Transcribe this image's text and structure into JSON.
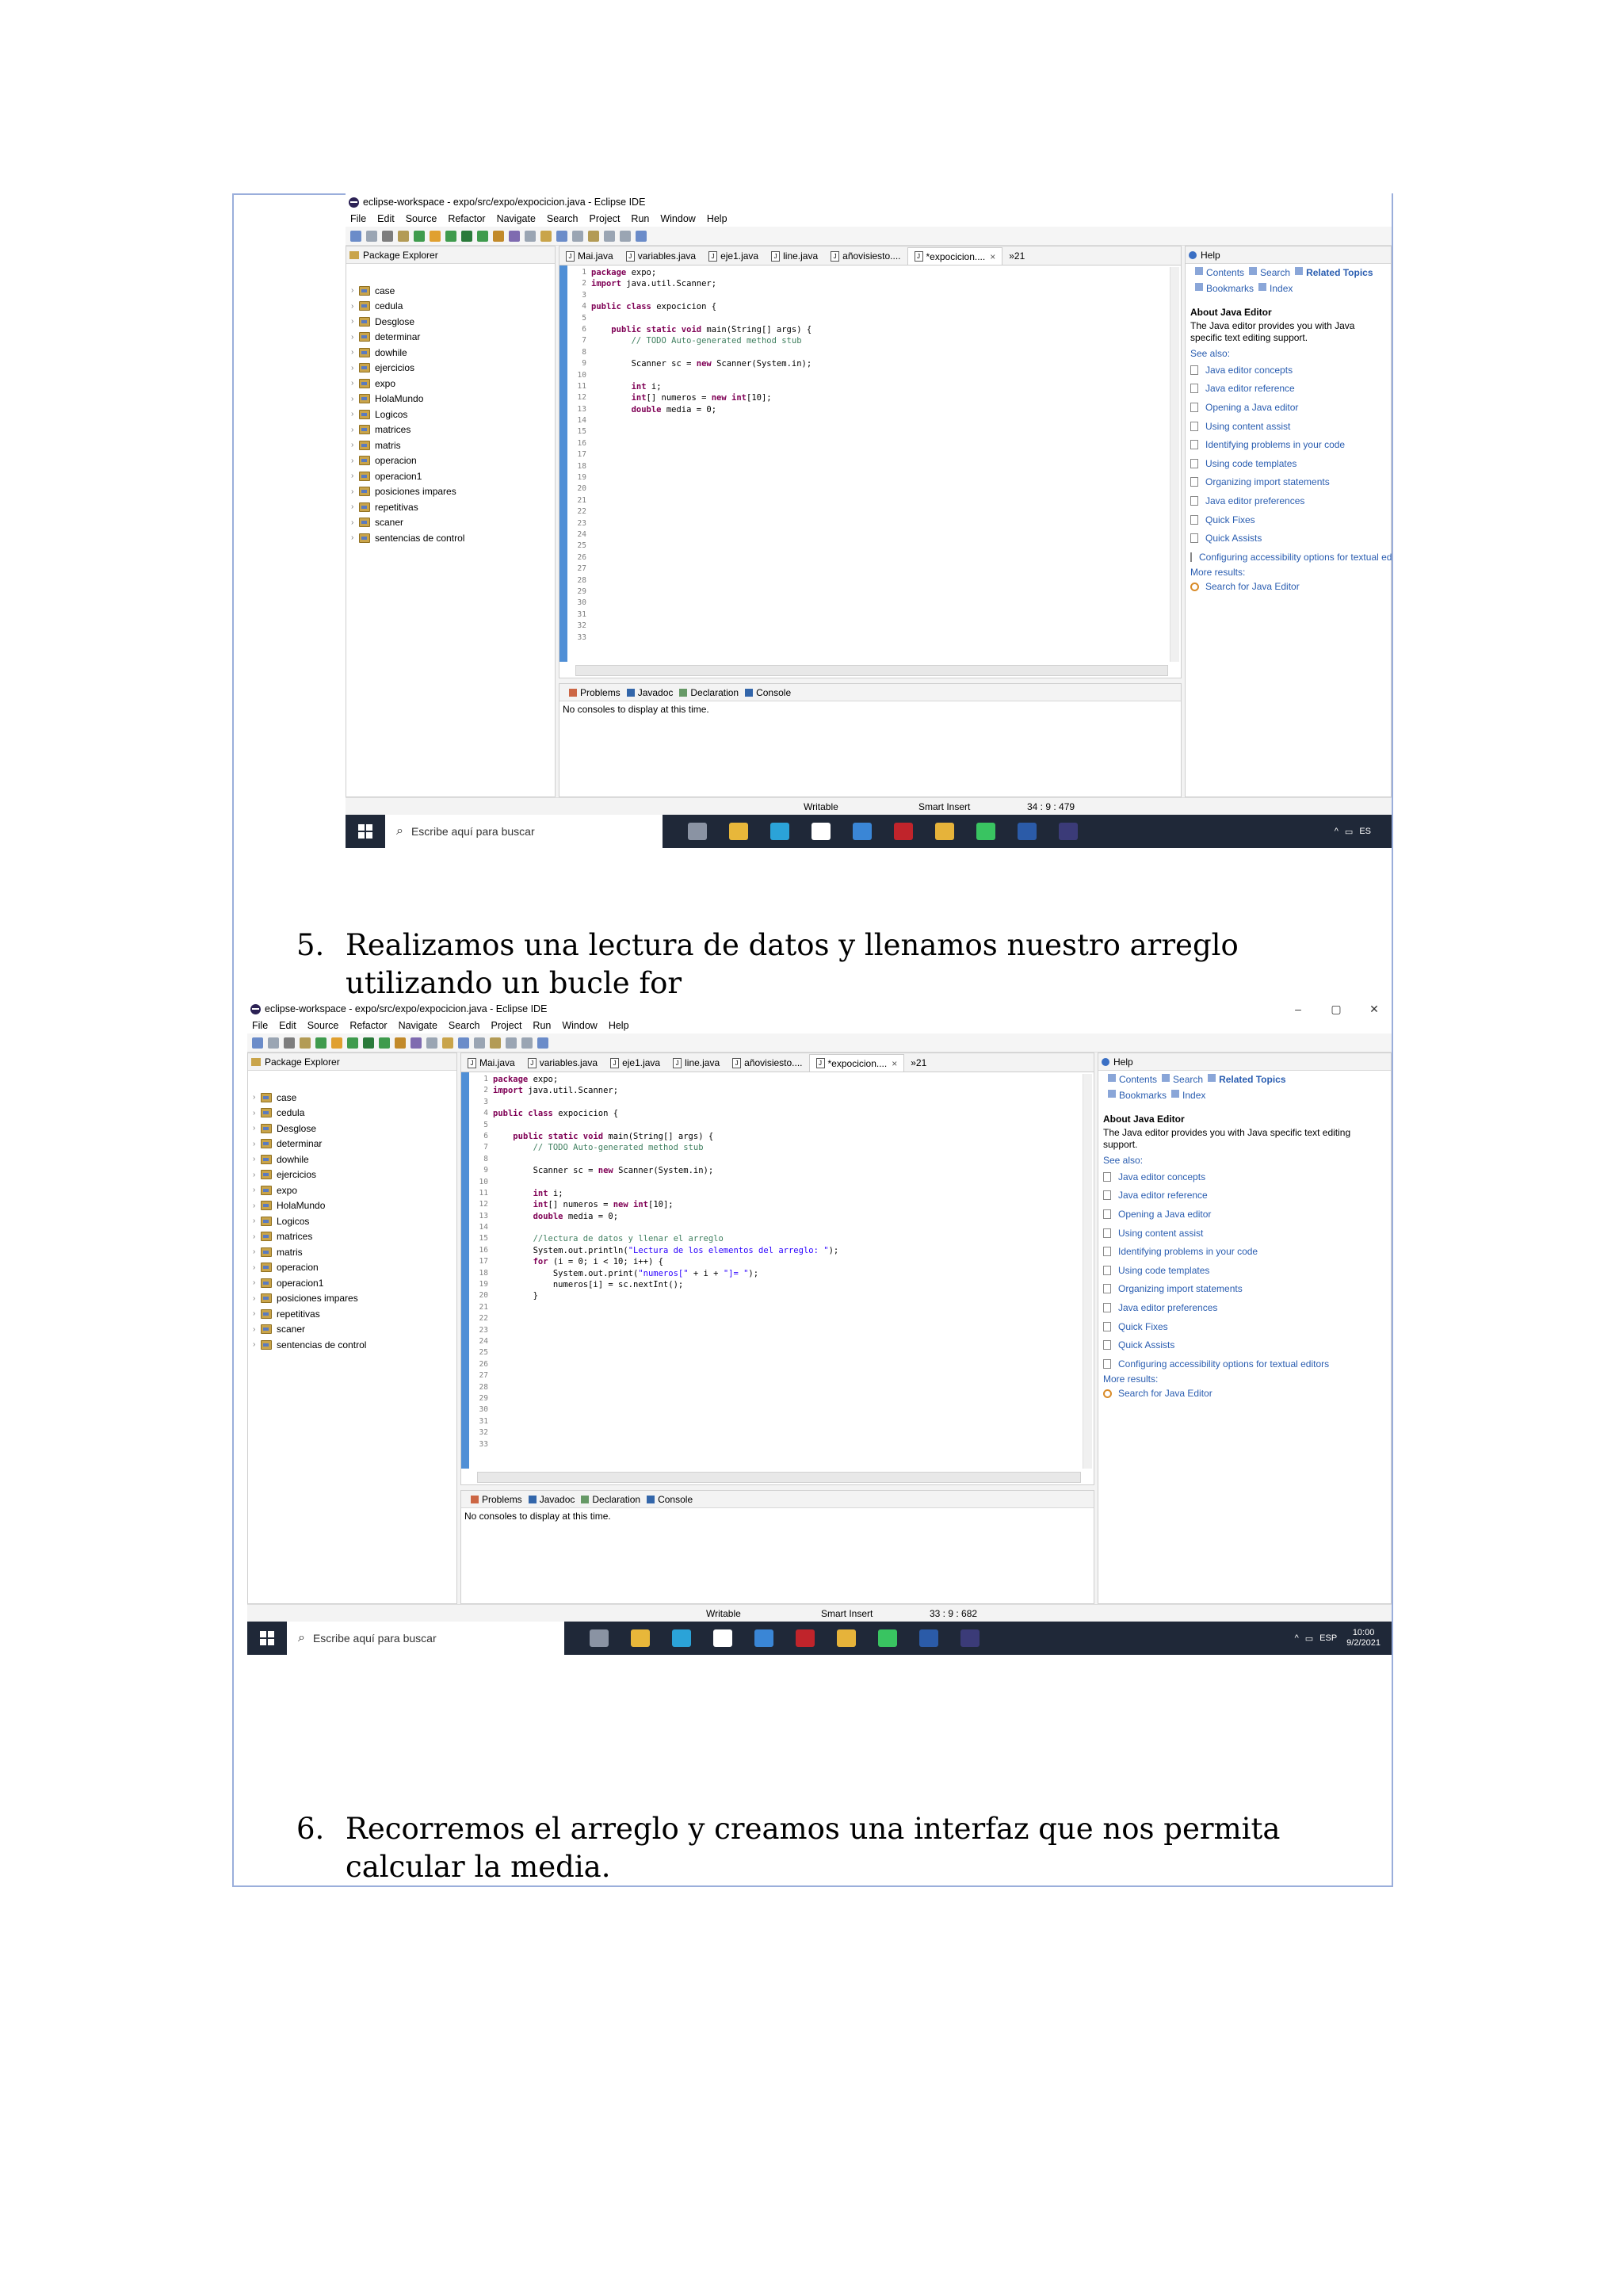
{
  "steps": [
    {
      "number": "5.",
      "text": "Realizamos una lectura de datos y llenamos nuestro arreglo utilizando un bucle for"
    },
    {
      "number": "6.",
      "text": "Recorremos el arreglo y creamos una interfaz que nos permita calcular la media."
    }
  ],
  "shots": [
    {
      "window_title": "eclipse-workspace - expo/src/expo/expocicion.java - Eclipse IDE",
      "menu": [
        "File",
        "Edit",
        "Source",
        "Refactor",
        "Navigate",
        "Search",
        "Project",
        "Run",
        "Window",
        "Help"
      ],
      "explorer_title": "Package Explorer",
      "projects": [
        "case",
        "cedula",
        "Desglose",
        "determinar",
        "dowhile",
        "ejercicios",
        "expo",
        "HolaMundo",
        "Logicos",
        "matrices",
        "matris",
        "operacion",
        "operacion1",
        "posiciones impares",
        "repetitivas",
        "scaner",
        "sentencias de control"
      ],
      "editor_tabs": [
        "Mai.java",
        "variables.java",
        "eje1.java",
        "line.java",
        "añovisiesto....",
        "*expocicion...."
      ],
      "tab_overflow": "»21",
      "code": [
        [
          [
            "kw",
            "package "
          ],
          [
            "",
            "expo;"
          ]
        ],
        [
          [
            "kw",
            "import "
          ],
          [
            "",
            "java.util.Scanner;"
          ]
        ],
        [
          [
            "",
            ""
          ]
        ],
        [
          [
            "kw",
            "public class "
          ],
          [
            "",
            "expocicion {"
          ]
        ],
        [
          [
            "",
            ""
          ]
        ],
        [
          [
            "",
            "    "
          ],
          [
            "kw",
            "public static void "
          ],
          [
            "",
            "main(String[] args) {"
          ]
        ],
        [
          [
            "",
            "        "
          ],
          [
            "cm",
            "// TODO Auto-generated method stub"
          ]
        ],
        [
          [
            "",
            ""
          ]
        ],
        [
          [
            "",
            "        Scanner sc = "
          ],
          [
            "kw",
            "new "
          ],
          [
            "",
            "Scanner(System.in);"
          ]
        ],
        [
          [
            "",
            ""
          ]
        ],
        [
          [
            "",
            "        "
          ],
          [
            "kw",
            "int "
          ],
          [
            "",
            "i;"
          ]
        ],
        [
          [
            "",
            "        "
          ],
          [
            "kw",
            "int"
          ],
          [
            "",
            "[] numeros = "
          ],
          [
            "kw",
            "new int"
          ],
          [
            "",
            "[10];"
          ]
        ],
        [
          [
            "",
            "        "
          ],
          [
            "kw",
            "double "
          ],
          [
            "",
            "media = 0;"
          ]
        ]
      ],
      "line_count": 33,
      "console_tabs": [
        "Problems",
        "Javadoc",
        "Declaration",
        "Console"
      ],
      "console_message": "No consoles to display at this time.",
      "help": {
        "title": "Help",
        "nav": [
          "Contents",
          "Search",
          "Related Topics"
        ],
        "nav2": [
          "Bookmarks",
          "Index"
        ],
        "about_title": "About Java Editor",
        "about_text": "The Java editor provides you with Java specific text editing support.",
        "see_also": "See also:",
        "links": [
          "Java editor concepts",
          "Java editor reference",
          "Opening a Java editor",
          "Using content assist",
          "Identifying problems in your code",
          "Using code templates",
          "Organizing import statements",
          "Java editor preferences",
          "Quick Fixes",
          "Quick Assists",
          "Configuring accessibility options for textual editors"
        ],
        "more_results": "More results:",
        "search_link": "Search for Java Editor"
      },
      "status": {
        "mode": "Writable",
        "insert": "Smart Insert",
        "position": "34 : 9 : 479"
      },
      "taskbar": {
        "search_placeholder": "Escribe aquí para buscar",
        "lang": "ES",
        "time": "",
        "date": ""
      }
    },
    {
      "window_title": "eclipse-workspace - expo/src/expo/expocicion.java - Eclipse IDE",
      "menu": [
        "File",
        "Edit",
        "Source",
        "Refactor",
        "Navigate",
        "Search",
        "Project",
        "Run",
        "Window",
        "Help"
      ],
      "explorer_title": "Package Explorer",
      "projects": [
        "case",
        "cedula",
        "Desglose",
        "determinar",
        "dowhile",
        "ejercicios",
        "expo",
        "HolaMundo",
        "Logicos",
        "matrices",
        "matris",
        "operacion",
        "operacion1",
        "posiciones impares",
        "repetitivas",
        "scaner",
        "sentencias de control"
      ],
      "editor_tabs": [
        "Mai.java",
        "variables.java",
        "eje1.java",
        "line.java",
        "añovisiesto....",
        "*expocicion...."
      ],
      "tab_overflow": "»21",
      "code": [
        [
          [
            "kw",
            "package "
          ],
          [
            "",
            "expo;"
          ]
        ],
        [
          [
            "kw",
            "import "
          ],
          [
            "",
            "java.util.Scanner;"
          ]
        ],
        [
          [
            "",
            ""
          ]
        ],
        [
          [
            "kw",
            "public class "
          ],
          [
            "",
            "expocicion {"
          ]
        ],
        [
          [
            "",
            ""
          ]
        ],
        [
          [
            "",
            "    "
          ],
          [
            "kw",
            "public static void "
          ],
          [
            "",
            "main(String[] args) {"
          ]
        ],
        [
          [
            "",
            "        "
          ],
          [
            "cm",
            "// TODO Auto-generated method stub"
          ]
        ],
        [
          [
            "",
            ""
          ]
        ],
        [
          [
            "",
            "        Scanner sc = "
          ],
          [
            "kw",
            "new "
          ],
          [
            "",
            "Scanner(System.in);"
          ]
        ],
        [
          [
            "",
            ""
          ]
        ],
        [
          [
            "",
            "        "
          ],
          [
            "kw",
            "int "
          ],
          [
            "",
            "i;"
          ]
        ],
        [
          [
            "",
            "        "
          ],
          [
            "kw",
            "int"
          ],
          [
            "",
            "[] numeros = "
          ],
          [
            "kw",
            "new int"
          ],
          [
            "",
            "[10];"
          ]
        ],
        [
          [
            "",
            "        "
          ],
          [
            "kw",
            "double "
          ],
          [
            "",
            "media = 0;"
          ]
        ],
        [
          [
            "",
            ""
          ]
        ],
        [
          [
            "",
            "        "
          ],
          [
            "cm",
            "//lectura de datos y llenar el arreglo"
          ]
        ],
        [
          [
            "",
            "        System.out.println("
          ],
          [
            "st",
            "\"Lectura de los elementos del arreglo: \""
          ],
          [
            "",
            ");"
          ]
        ],
        [
          [
            "",
            "        "
          ],
          [
            "kw",
            "for "
          ],
          [
            "",
            "(i = 0; i < 10; i++) {"
          ]
        ],
        [
          [
            "",
            "            System.out.print("
          ],
          [
            "st",
            "\"numeros[\""
          ],
          [
            "",
            " + i + "
          ],
          [
            "st",
            "\"]= \""
          ],
          [
            "",
            ");"
          ]
        ],
        [
          [
            "",
            "            numeros[i] = sc.nextInt();"
          ]
        ],
        [
          [
            "",
            "        }"
          ]
        ]
      ],
      "line_count": 33,
      "console_tabs": [
        "Problems",
        "Javadoc",
        "Declaration",
        "Console"
      ],
      "console_message": "No consoles to display at this time.",
      "help": {
        "title": "Help",
        "nav": [
          "Contents",
          "Search",
          "Related Topics"
        ],
        "nav2": [
          "Bookmarks",
          "Index"
        ],
        "about_title": "About Java Editor",
        "about_text": "The Java editor provides you with Java specific text editing support.",
        "see_also": "See also:",
        "links": [
          "Java editor concepts",
          "Java editor reference",
          "Opening a Java editor",
          "Using content assist",
          "Identifying problems in your code",
          "Using code templates",
          "Organizing import statements",
          "Java editor preferences",
          "Quick Fixes",
          "Quick Assists",
          "Configuring accessibility options for textual editors"
        ],
        "more_results": "More results:",
        "search_link": "Search for Java Editor"
      },
      "status": {
        "mode": "Writable",
        "insert": "Smart Insert",
        "position": "33 : 9 : 682"
      },
      "taskbar": {
        "search_placeholder": "Escribe aquí para buscar",
        "lang": "ESP",
        "time": "10:00",
        "date": "9/2/2021"
      }
    }
  ],
  "colors": {
    "frame": "#9aaedb",
    "taskbar": "#1f2838",
    "keyword": "#7f0055",
    "comment": "#3f7f5f",
    "string": "#2a00ff",
    "link": "#2a5db0"
  }
}
